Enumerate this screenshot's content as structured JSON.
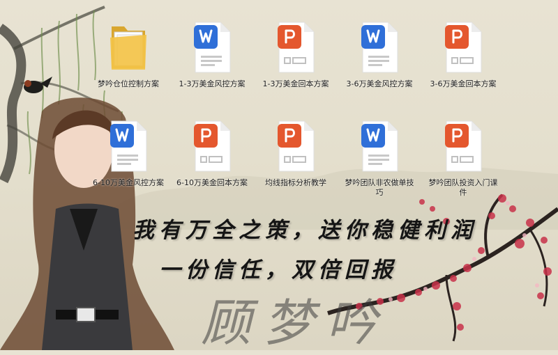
{
  "desktop": {
    "icons": [
      {
        "label": "梦吟仓位控制方案",
        "type": "folder"
      },
      {
        "label": "1-3万美金风控方案",
        "type": "word"
      },
      {
        "label": "1-3万美金回本方案",
        "type": "ppt"
      },
      {
        "label": "3-6万美金风控方案",
        "type": "word"
      },
      {
        "label": "3-6万美金回本方案",
        "type": "ppt"
      },
      {
        "label": "6-10万美金风控方案",
        "type": "word"
      },
      {
        "label": "6-10万美金回本方案",
        "type": "ppt"
      },
      {
        "label": "均线指标分析教学",
        "type": "ppt"
      },
      {
        "label": "梦吟团队非农做单技巧",
        "type": "word"
      },
      {
        "label": "梦吟团队投资入门课件",
        "type": "ppt"
      }
    ]
  },
  "wallpaper": {
    "slogan_line1": "我有万全之策，送你稳健利润",
    "slogan_line2": "一份信任，双倍回报",
    "signature": "顾梦吟"
  },
  "colors": {
    "word_blue": "#2f6fd8",
    "ppt_orange": "#e4572e",
    "folder_yellow": "#f3c348",
    "background": "#e6e1cf"
  }
}
